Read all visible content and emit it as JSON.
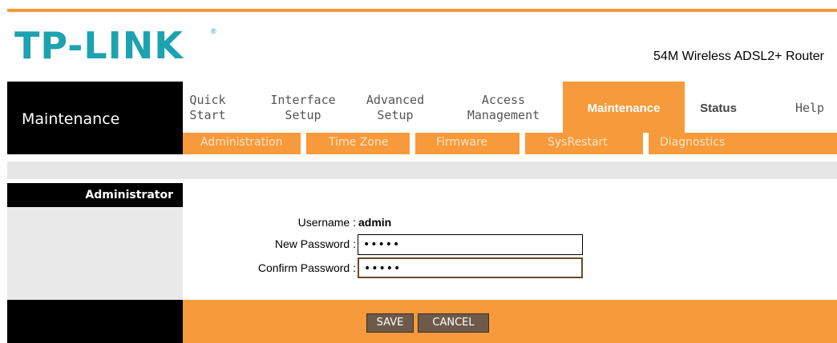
{
  "brand": {
    "logo_text": "TP-LINK",
    "reg_mark": "®",
    "model": "54M Wireless ADSL2+ Router"
  },
  "section": {
    "title": "Maintenance"
  },
  "nav": {
    "items": [
      {
        "label_line1": "Quick",
        "label_line2": "Start"
      },
      {
        "label_line1": "Interface",
        "label_line2": "Setup"
      },
      {
        "label_line1": "Advanced",
        "label_line2": "Setup"
      },
      {
        "label_line1": "Access",
        "label_line2": "Management"
      },
      {
        "label_line1": "Maintenance",
        "label_line2": ""
      },
      {
        "label_line1": "Status",
        "label_line2": ""
      },
      {
        "label_line1": "Help",
        "label_line2": ""
      }
    ],
    "active_index": 4
  },
  "subnav": {
    "items": [
      "Administration",
      "Time Zone",
      "Firmware",
      "SysRestart",
      "Diagnostics"
    ]
  },
  "panel": {
    "heading": "Administrator"
  },
  "form": {
    "username_label": "Username :",
    "username_value": "admin",
    "new_password_label": "New Password :",
    "new_password_value": "•••••",
    "confirm_password_label": "Confirm Password :",
    "confirm_password_value": "•••••"
  },
  "actions": {
    "save": "SAVE",
    "cancel": "CANCEL"
  },
  "colors": {
    "accent": "#f79a3b",
    "logo": "#1da2b0",
    "dark": "#000000",
    "button": "#6e5a4a"
  }
}
